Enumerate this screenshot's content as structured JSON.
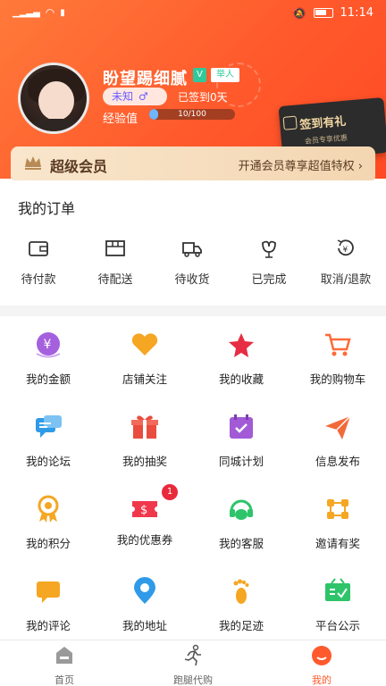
{
  "status_bar": {
    "left": "46",
    "time": "11:14"
  },
  "profile": {
    "name": "盼望踢细腻",
    "vip_mark": "V",
    "level": "举人",
    "gender_text": "未知",
    "gender_symbol": "♂",
    "signed": "已签到0天",
    "exp_label": "经验值",
    "exp_text": "10/100",
    "exp_progress": 0.1
  },
  "sign_card": {
    "title": "签到有礼",
    "subtitle": "会员专享优惠"
  },
  "member": {
    "title": "超级会员",
    "link": "开通会员尊享超值特权 ›"
  },
  "orders": {
    "title": "我的订单",
    "items": [
      {
        "label": "待付款",
        "icon": "wallet-icon"
      },
      {
        "label": "待配送",
        "icon": "package-icon"
      },
      {
        "label": "待收货",
        "icon": "truck-icon"
      },
      {
        "label": "已完成",
        "icon": "tulip-icon"
      },
      {
        "label": "取消/退款",
        "icon": "refund-icon"
      }
    ]
  },
  "grid": [
    {
      "label": "我的金额",
      "icon": "money-icon",
      "color": "#9b59d6"
    },
    {
      "label": "店铺关注",
      "icon": "heart-icon",
      "color": "#f5a623"
    },
    {
      "label": "我的收藏",
      "icon": "star-icon",
      "color": "#e62d43"
    },
    {
      "label": "我的购物车",
      "icon": "cart-icon",
      "color": "#ff6b3a"
    },
    {
      "label": "我的论坛",
      "icon": "forum-icon",
      "color": "#2f9be8"
    },
    {
      "label": "我的抽奖",
      "icon": "gift-icon",
      "color": "#e94d3f"
    },
    {
      "label": "同城计划",
      "icon": "calendar-icon",
      "color": "#a25ad6"
    },
    {
      "label": "信息发布",
      "icon": "send-icon",
      "color": "#f26a3a"
    },
    {
      "label": "我的积分",
      "icon": "medal-icon",
      "color": "#f5a623"
    },
    {
      "label": "我的优惠券",
      "icon": "coupon-icon",
      "color": "#f0384c",
      "badge": "1"
    },
    {
      "label": "我的客服",
      "icon": "headset-icon",
      "color": "#2fc46a"
    },
    {
      "label": "邀请有奖",
      "icon": "network-icon",
      "color": "#f5a623"
    },
    {
      "label": "我的评论",
      "icon": "comment-icon",
      "color": "#f5a623"
    },
    {
      "label": "我的地址",
      "icon": "location-icon",
      "color": "#2f9be8"
    },
    {
      "label": "我的足迹",
      "icon": "footprint-icon",
      "color": "#f5a623"
    },
    {
      "label": "平台公示",
      "icon": "notice-icon",
      "color": "#2fc46a"
    }
  ],
  "nav": [
    {
      "label": "首页",
      "icon": "home-icon",
      "active": false
    },
    {
      "label": "跑腿代购",
      "icon": "runner-icon",
      "active": false
    },
    {
      "label": "我的",
      "icon": "profile-icon",
      "active": true
    }
  ],
  "colors": {
    "accent": "#ff5a2c",
    "header": "#ff6a33",
    "member_bg": "#f6ddbd"
  }
}
